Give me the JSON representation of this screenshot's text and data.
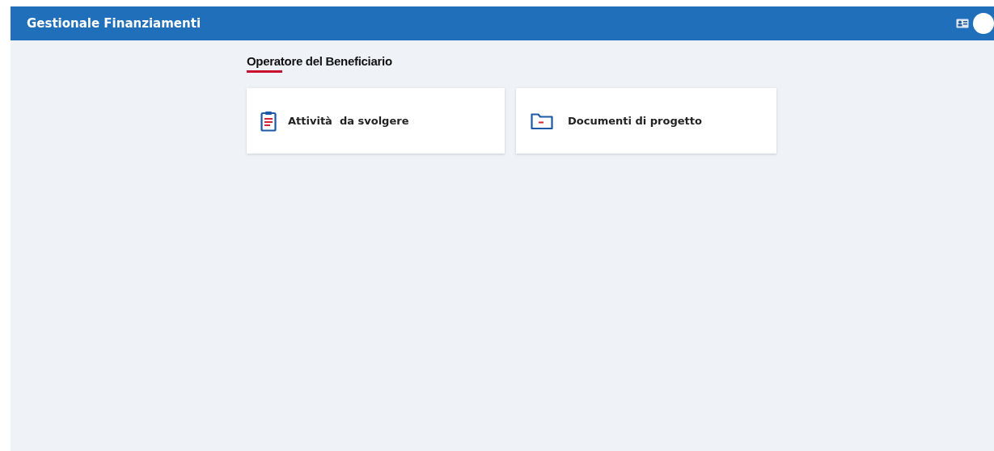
{
  "header": {
    "title": "Gestionale Finanziamenti"
  },
  "section": {
    "title": "Operatore del Beneficiario"
  },
  "cards": [
    {
      "kind": "clipboard",
      "label": "Attività  da svolgere"
    },
    {
      "kind": "folder",
      "label": "Documenti di progetto"
    }
  ]
}
